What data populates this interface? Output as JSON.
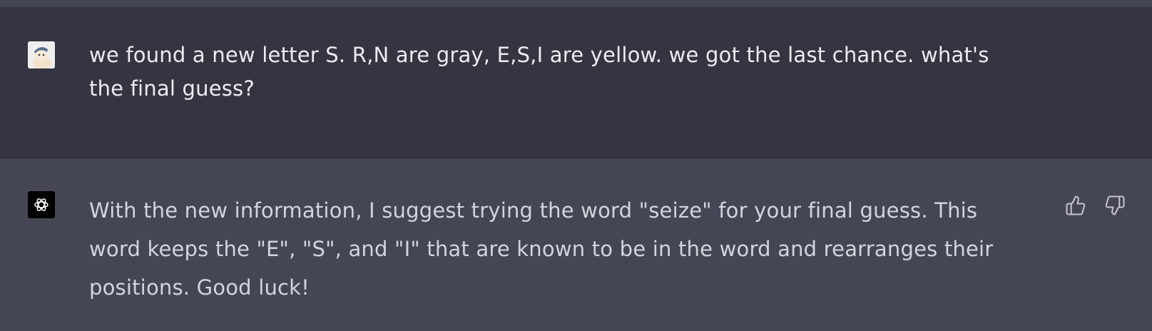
{
  "conversation": {
    "user_message": {
      "text": "we found a new letter S. R,N are gray, E,S,I are yellow. we got the last chance. what's the final guess?",
      "avatar_icon": "user-avatar"
    },
    "assistant_message": {
      "text": "With the new information, I suggest trying the word \"seize\" for your final guess. This word keeps the \"E\", \"S\", and \"I\" that are known to be in the word and rearranges their positions. Good luck!",
      "avatar_icon": "openai-logo-icon",
      "actions": [
        {
          "name": "thumbs-up-icon"
        },
        {
          "name": "thumbs-down-icon"
        }
      ]
    }
  },
  "colors": {
    "user_bg": "#343541",
    "assistant_bg": "#444654",
    "text": "#ececf1"
  }
}
